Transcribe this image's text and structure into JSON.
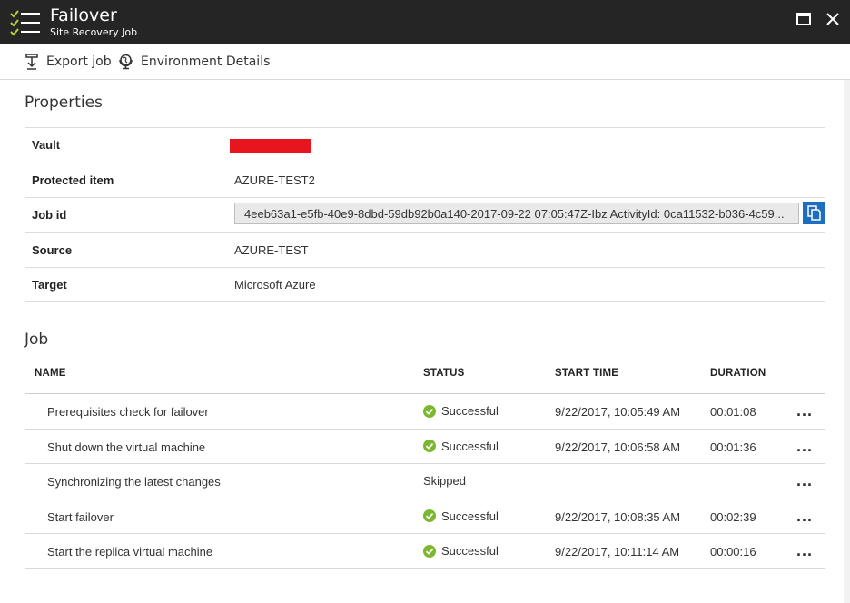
{
  "window": {
    "title": "Failover",
    "subtitle": "Site Recovery Job",
    "icon": "checklist-icon"
  },
  "toolbar": {
    "export_label": "Export job",
    "environment_label": "Environment Details"
  },
  "properties": {
    "heading": "Properties",
    "rows": [
      {
        "label": "Vault",
        "value": ""
      },
      {
        "label": "Protected item",
        "value": "AZURE-TEST2"
      },
      {
        "label": "Job id",
        "value": "4eeb63a1-e5fb-40e9-8dbd-59db92b0a140-2017-09-22 07:05:47Z-Ibz ActivityId: 0ca11532-b036-4c59..."
      },
      {
        "label": "Source",
        "value": "AZURE-TEST"
      },
      {
        "label": "Target",
        "value": "Microsoft Azure"
      }
    ]
  },
  "job": {
    "heading": "Job",
    "columns": {
      "name": "NAME",
      "status": "STATUS",
      "start_time": "START TIME",
      "duration": "DURATION"
    },
    "rows": [
      {
        "name": "Prerequisites check for failover",
        "status": "Successful",
        "start_time": "9/22/2017, 10:05:49 AM",
        "duration": "00:01:08",
        "more": "..."
      },
      {
        "name": "Shut down the virtual machine",
        "status": "Successful",
        "start_time": "9/22/2017, 10:06:58 AM",
        "duration": "00:01:36",
        "more": "..."
      },
      {
        "name": "Synchronizing the latest changes",
        "status": "Skipped",
        "start_time": "",
        "duration": "",
        "more": "..."
      },
      {
        "name": "Start failover",
        "status": "Successful",
        "start_time": "9/22/2017, 10:08:35 AM",
        "duration": "00:02:39",
        "more": "..."
      },
      {
        "name": "Start the replica virtual machine",
        "status": "Successful",
        "start_time": "9/22/2017, 10:11:14 AM",
        "duration": "00:00:16",
        "more": "..."
      }
    ]
  },
  "colors": {
    "titlebar": "#252525",
    "success": "#7cb82f",
    "redaction": "#e8141e",
    "copy_button": "#1e6ebf"
  }
}
